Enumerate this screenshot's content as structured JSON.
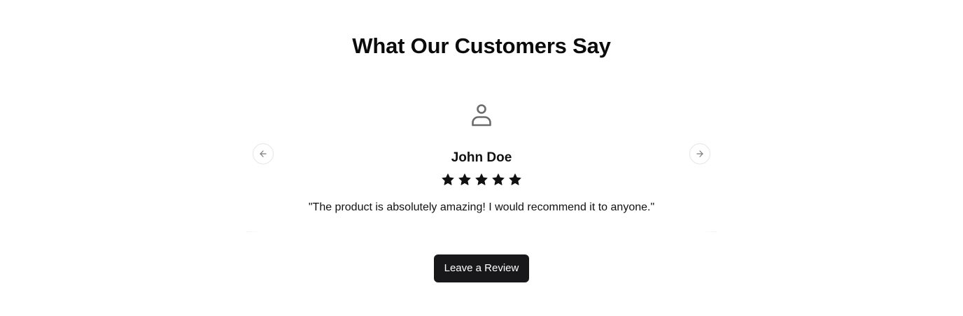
{
  "section": {
    "title": "What Our Customers Say"
  },
  "testimonial": {
    "avatar_icon": "user-icon",
    "name": "John Doe",
    "rating": 5,
    "rating_max": 5,
    "quote": "\"The product is absolutely amazing! I would recommend it to anyone.\""
  },
  "carousel": {
    "prev_icon": "arrow-left-icon",
    "next_icon": "arrow-right-icon"
  },
  "cta": {
    "label": "Leave a Review"
  },
  "colors": {
    "text": "#111111",
    "star": "#111111",
    "icon_gray": "#6b6b6b",
    "button_bg": "#18181b",
    "button_text": "#ffffff"
  }
}
